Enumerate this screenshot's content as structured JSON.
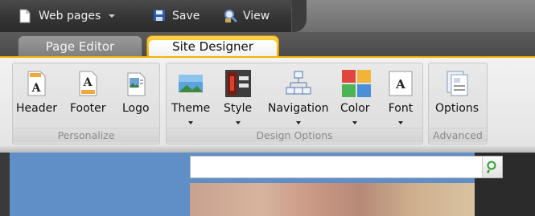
{
  "quick_access": {
    "web_pages": "Web pages",
    "save": "Save",
    "view": "View"
  },
  "tabs": [
    {
      "label": "Page Editor",
      "selected": false
    },
    {
      "label": "Site Designer",
      "selected": true
    }
  ],
  "ribbon": {
    "groups": [
      {
        "label": "Personalize",
        "buttons": [
          {
            "label": "Header",
            "icon": "header-icon"
          },
          {
            "label": "Footer",
            "icon": "footer-icon"
          },
          {
            "label": "Logo",
            "icon": "logo-icon"
          }
        ]
      },
      {
        "label": "Design Options",
        "buttons": [
          {
            "label": "Theme",
            "icon": "theme-icon",
            "dropdown": true
          },
          {
            "label": "Style",
            "icon": "style-icon",
            "dropdown": true
          },
          {
            "label": "Navigation",
            "icon": "navigation-icon",
            "dropdown": true
          },
          {
            "label": "Color",
            "icon": "color-icon",
            "dropdown": true
          },
          {
            "label": "Font",
            "icon": "font-icon",
            "dropdown": true
          }
        ]
      },
      {
        "label": "Advanced",
        "buttons": [
          {
            "label": "Options",
            "icon": "options-icon"
          }
        ]
      }
    ]
  },
  "search": {
    "placeholder": "",
    "value": ""
  },
  "colors": {
    "accent_tab": "#f3a800",
    "toolbar": "#333333",
    "canvas_left": "#5f8fc6"
  }
}
